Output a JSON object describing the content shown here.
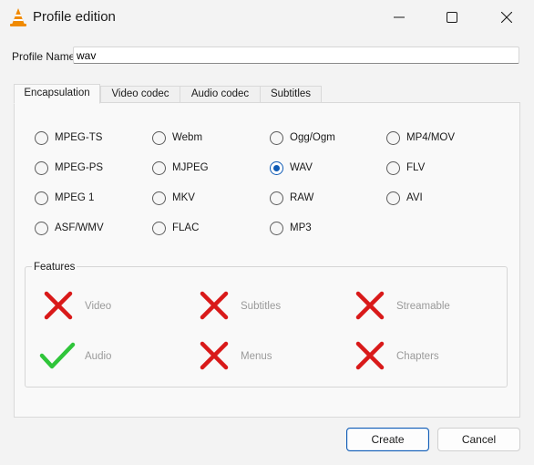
{
  "window": {
    "title": "Profile edition"
  },
  "profile": {
    "label": "Profile Name",
    "value": "wav"
  },
  "tabs": [
    {
      "label": "Encapsulation",
      "active": true
    },
    {
      "label": "Video codec",
      "active": false
    },
    {
      "label": "Audio codec",
      "active": false
    },
    {
      "label": "Subtitles",
      "active": false
    }
  ],
  "formats": [
    [
      "MPEG-TS",
      "Webm",
      "Ogg/Ogm",
      "MP4/MOV"
    ],
    [
      "MPEG-PS",
      "MJPEG",
      "WAV",
      "FLV"
    ],
    [
      "MPEG 1",
      "MKV",
      "RAW",
      "AVI"
    ],
    [
      "ASF/WMV",
      "FLAC",
      "MP3",
      ""
    ]
  ],
  "selected_format": "WAV",
  "features": {
    "title": "Features",
    "items": [
      {
        "label": "Video",
        "supported": false
      },
      {
        "label": "Subtitles",
        "supported": false
      },
      {
        "label": "Streamable",
        "supported": false
      },
      {
        "label": "Audio",
        "supported": true
      },
      {
        "label": "Menus",
        "supported": false
      },
      {
        "label": "Chapters",
        "supported": false
      }
    ]
  },
  "buttons": {
    "create": "Create",
    "cancel": "Cancel"
  },
  "colors": {
    "accent": "#0f5bb5",
    "cross": "#d91a1a",
    "check": "#2fc53a",
    "vlc_orange": "#f08a00"
  }
}
